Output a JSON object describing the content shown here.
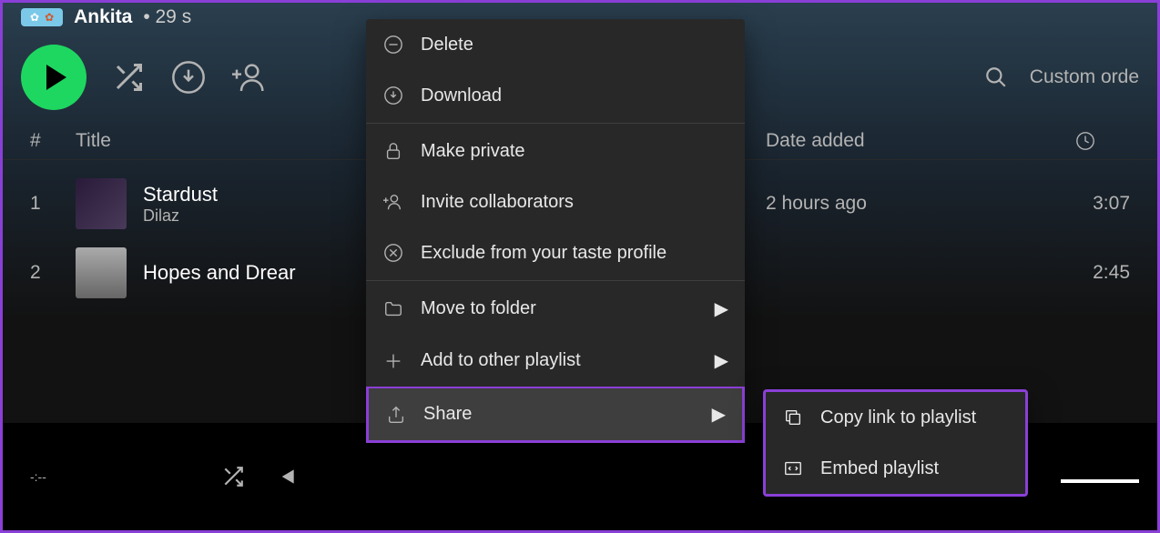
{
  "header": {
    "owner": "Ankita",
    "meta": "• 29 s"
  },
  "controls": {
    "sort": "Custom orde"
  },
  "columns": {
    "num": "#",
    "title": "Title",
    "date": "Date added"
  },
  "tracks": [
    {
      "num": "1",
      "title": "Stardust",
      "artist": "Dilaz",
      "date": "2 hours ago",
      "dur": "3:07"
    },
    {
      "num": "2",
      "title": "Hopes and Drear",
      "artist": "",
      "date": "",
      "dur": "2:45"
    }
  ],
  "player": {
    "time": "-:--"
  },
  "context": {
    "delete": "Delete",
    "download": "Download",
    "private": "Make private",
    "invite": "Invite collaborators",
    "exclude": "Exclude from your taste profile",
    "move": "Move to folder",
    "add": "Add to other playlist",
    "share": "Share"
  },
  "submenu": {
    "copy": "Copy link to playlist",
    "embed": "Embed playlist"
  }
}
